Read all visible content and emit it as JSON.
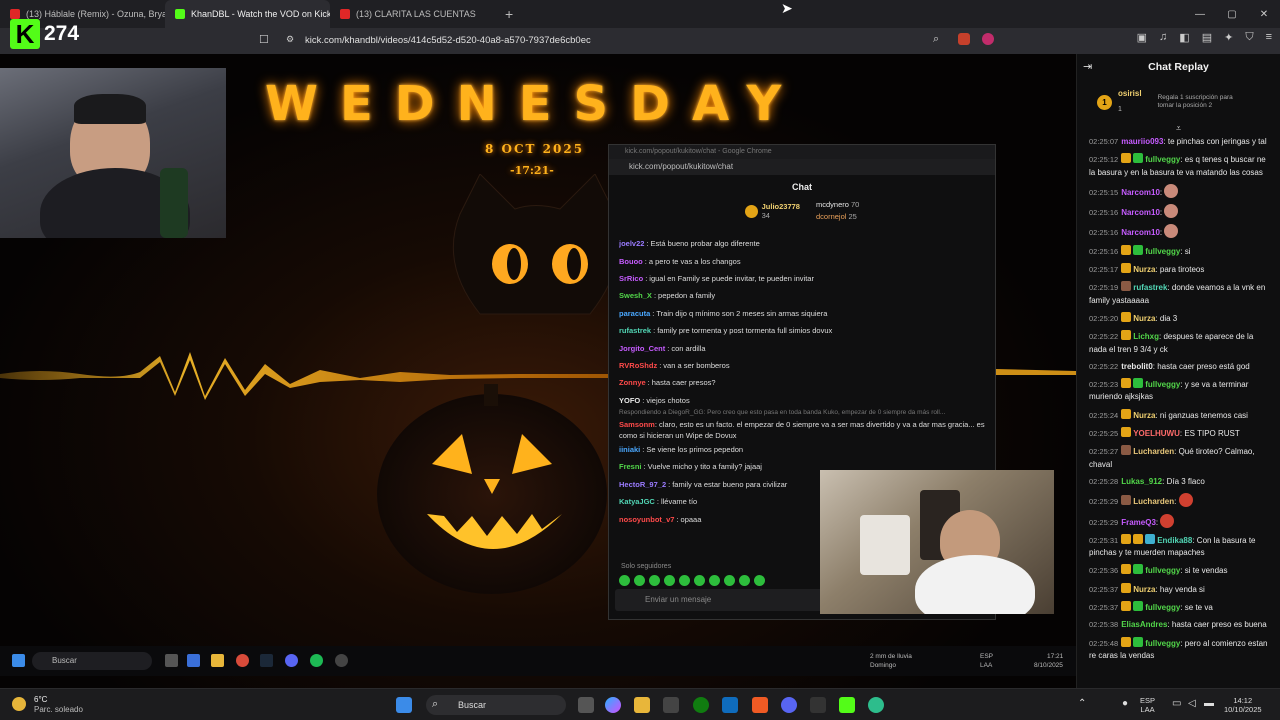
{
  "browser": {
    "tabs": [
      {
        "title": "(13) Háblale (Remix) - Ozuna, Bryant",
        "favicon_color": "#e02727",
        "active": false
      },
      {
        "title": "KhanDBL - Watch the VOD on Kick",
        "favicon_color": "#53fc18",
        "active": true
      },
      {
        "title": "(13) CLARITA LAS CUENTAS",
        "favicon_color": "#e02727",
        "active": false
      }
    ],
    "new_tab": "+",
    "url": "kick.com/khandbl/videos/414c5d52-d520-40a8-a570-7937de6cb0ec",
    "window_controls": [
      "—",
      "▢",
      "✕"
    ]
  },
  "overlay": {
    "viewer_count": "274",
    "logo_letter": "K"
  },
  "stream": {
    "title_text": "WEDNESDAY",
    "date_text": "8  OCT  2025",
    "time_text": "-17:21-"
  },
  "popup": {
    "window_title": "kick.com/popout/kukitow/chat - Google Chrome",
    "url": "kick.com/popout/kukitow/chat",
    "header": "Chat",
    "top_gifter": {
      "name": "Julio23778",
      "amount": "34"
    },
    "top_others": [
      {
        "name": "mcdynero",
        "amount": "70"
      },
      {
        "name": "dcornejol",
        "amount": "25"
      }
    ],
    "messages": [
      {
        "user": "joelv22",
        "color": "#9a7bff",
        "text": "Está bueno probar algo diferente"
      },
      {
        "user": "Bouoo",
        "color": "#c65cff",
        "text": "a pero te vas a los changos"
      },
      {
        "user": "SrRico",
        "color": "#c65cff",
        "text": "igual en Family se puede invitar, te pueden invitar"
      },
      {
        "user": "Swesh_X",
        "color": "#52d64a",
        "text": "pepedon a family"
      },
      {
        "user": "paracuta",
        "color": "#4aa8ff",
        "text": "Train dijo q mínimo son 2 meses sin armas siquiera"
      },
      {
        "user": "rufastrek",
        "color": "#52d6b5",
        "text": "family pre tormenta y post tormenta full simios dovux"
      },
      {
        "user": "Jorgito_Cent",
        "color": "#c65cff",
        "text": "con ardilla"
      },
      {
        "user": "RVRoShdz",
        "color": "#ff4a4a",
        "text": "van a ser bomberos"
      },
      {
        "user": "Zonnye",
        "color": "#ff4a4a",
        "text": "hasta caer presos?"
      },
      {
        "user": "YOFO",
        "color": "#e8e8e8",
        "text": "viejos chotos"
      }
    ],
    "reply_context": "Respondiendo a DiegoR_GG: Pero creo que esto pasa en toda banda Kuko, empezar de 0 siempre da más roll...",
    "reply_user": "Samsonm",
    "reply_text": "claro, esto es un facto. el empezar de 0 siempre va a ser mas divertido y va a dar mas gracia... es como si hicieran un Wipe de Dovux",
    "messages2": [
      {
        "user": "iiniaki",
        "color": "#4aa8ff",
        "text": "Se viene los primos pepedon"
      },
      {
        "user": "Fresni",
        "color": "#52d64a",
        "text": "Vuelve micho y tito a family? jajaaj"
      },
      {
        "user": "HectoR_97_2",
        "color": "#9a7bff",
        "text": "family va estar bueno para civilizar"
      },
      {
        "user": "KatyaJGC",
        "color": "#52d6b5",
        "text": "llévame tío"
      },
      {
        "user": "nosoyunbot_v7",
        "color": "#ff4a4a",
        "text": "opaaa"
      }
    ],
    "followers_only": "Solo seguidores",
    "input_placeholder": "Enviar un mensaje"
  },
  "inner_taskbar": {
    "search": "Buscar",
    "weather_line1": "2 mm de lluvia",
    "weather_line2": "Domingo",
    "lang": "ESP\nLAA",
    "time": "17:21",
    "date": "8/10/2025"
  },
  "chat": {
    "title": "Chat Replay",
    "pinned": {
      "rank": "1",
      "name": "osirisl",
      "count": "1",
      "cta": "Regala 1 suscripción para tomar la posición 2"
    },
    "messages": [
      {
        "ts": "02:25:07",
        "user": "mauriio093",
        "color": "#c65cff",
        "badges": [],
        "text": "te pinchas con jeringas y tal"
      },
      {
        "ts": "02:25:12",
        "user": "fullveggy",
        "color": "#52d64a",
        "badges": [
          "#e3a416",
          "#2dbd3c"
        ],
        "text": "es q tenes q buscar ne la basura y en la basura te va matando las cosas"
      },
      {
        "ts": "02:25:15",
        "user": "Narcom10",
        "color": "#c65cff",
        "badges": [],
        "text": "",
        "emote": "#c98a7a"
      },
      {
        "ts": "02:25:16",
        "user": "Narcom10",
        "color": "#c65cff",
        "badges": [],
        "text": "",
        "emote": "#c98a7a"
      },
      {
        "ts": "02:25:16",
        "user": "Narcom10",
        "color": "#c65cff",
        "badges": [],
        "text": "",
        "emote": "#c98a7a"
      },
      {
        "ts": "02:25:16",
        "user": "fullveggy",
        "color": "#52d64a",
        "badges": [
          "#e3a416",
          "#2dbd3c"
        ],
        "text": "si"
      },
      {
        "ts": "02:25:17",
        "user": "Nurza",
        "color": "#f0d070",
        "badges": [
          "#e3a416"
        ],
        "text": "para tiroteos"
      },
      {
        "ts": "02:25:19",
        "user": "rufastrek",
        "color": "#52d6b5",
        "badges": [
          "#8a5a44"
        ],
        "text": "donde veamos a la vnk en family yastaaaaa"
      },
      {
        "ts": "02:25:20",
        "user": "Nurza",
        "color": "#f0d070",
        "badges": [
          "#e3a416"
        ],
        "text": "dia 3"
      },
      {
        "ts": "02:25:22",
        "user": "Lichxg",
        "color": "#52d64a",
        "badges": [
          "#e3a416"
        ],
        "text": "despues te aparece de la nada el tren 9 3/4 y ck"
      },
      {
        "ts": "02:25:22",
        "user": "trebolit0",
        "color": "#e8e8e8",
        "badges": [],
        "text": "hasta caer preso está god"
      },
      {
        "ts": "02:25:23",
        "user": "fullveggy",
        "color": "#52d64a",
        "badges": [
          "#e3a416",
          "#2dbd3c"
        ],
        "text": "y se va a terminar muriendo ajksjkas"
      },
      {
        "ts": "02:25:24",
        "user": "Nurza",
        "color": "#f0d070",
        "badges": [
          "#e3a416"
        ],
        "text": "ni ganzuas tenemos casi"
      },
      {
        "ts": "02:25:25",
        "user": "YOELHUWU",
        "color": "#ff6b6b",
        "badges": [
          "#e3a416"
        ],
        "text": "ES TIPO RUST"
      },
      {
        "ts": "02:25:27",
        "user": "Lucharden",
        "color": "#e8c77a",
        "badges": [
          "#8a5a44"
        ],
        "text": "Qué tiroteo? Calmao, chaval"
      },
      {
        "ts": "02:25:28",
        "user": "Lukas_912",
        "color": "#52d64a",
        "badges": [],
        "text": "Día 3 flaco"
      },
      {
        "ts": "02:25:29",
        "user": "Lucharden",
        "color": "#e8c77a",
        "badges": [
          "#8a5a44"
        ],
        "text": "",
        "emote": "#d04030"
      },
      {
        "ts": "02:25:29",
        "user": "FrameQ3",
        "color": "#c65cff",
        "badges": [],
        "text": "",
        "emote": "#d04030"
      },
      {
        "ts": "02:25:31",
        "user": "Endika88",
        "color": "#52d6b5",
        "badges": [
          "#e3a416",
          "#e3a416",
          "#3fb0d0"
        ],
        "text": "Con la basura te pinchas y te muerden mapaches"
      },
      {
        "ts": "02:25:36",
        "user": "fullveggy",
        "color": "#52d64a",
        "badges": [
          "#e3a416",
          "#2dbd3c"
        ],
        "text": "si te vendas"
      },
      {
        "ts": "02:25:37",
        "user": "Nurza",
        "color": "#f0d070",
        "badges": [
          "#e3a416"
        ],
        "text": "hay venda si"
      },
      {
        "ts": "02:25:37",
        "user": "fullveggy",
        "color": "#52d64a",
        "badges": [
          "#e3a416",
          "#2dbd3c"
        ],
        "text": "se te va"
      },
      {
        "ts": "02:25:38",
        "user": "EliasAndres",
        "color": "#52d64a",
        "badges": [],
        "text": "hasta caer preso es buena"
      },
      {
        "ts": "02:25:48",
        "user": "fullveggy",
        "color": "#52d64a",
        "badges": [
          "#e3a416",
          "#2dbd3c"
        ],
        "text": "pero al comienzo estan re caras la vendas"
      }
    ]
  },
  "taskbar": {
    "temp": "6°C",
    "condition": "Parc. soleado",
    "search": "Buscar",
    "lang": "ESP",
    "lang2": "LAA",
    "time": "14:12",
    "date": "10/10/2025"
  }
}
